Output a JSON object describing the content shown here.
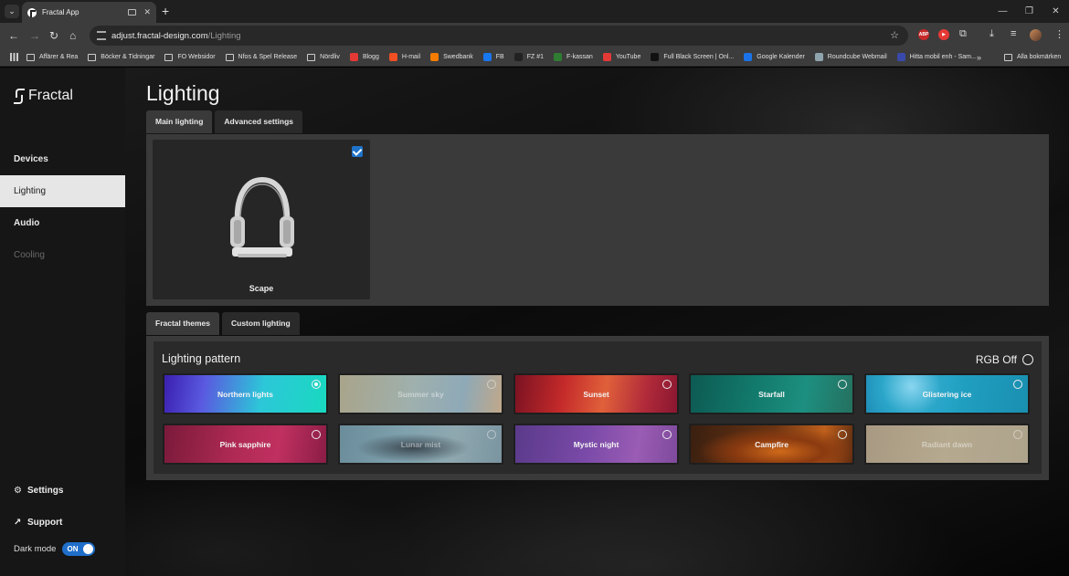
{
  "browser": {
    "tab_title": "Fractal App",
    "url_host": "adjust.fractal-design.com",
    "url_path": "/Lighting",
    "extensions": [
      {
        "name": "adblock-plus-icon",
        "label": "ABP",
        "color": "#c62828"
      },
      {
        "name": "youtube-ext-icon",
        "label": "▶",
        "color": "#e53935"
      }
    ],
    "bookmarks": [
      {
        "label": "Affärer & Rea",
        "icon": "folder"
      },
      {
        "label": "Böcker & Tidningar",
        "icon": "folder"
      },
      {
        "label": "FO Websidor",
        "icon": "folder"
      },
      {
        "label": "Nfos & Spel Release",
        "icon": "folder"
      },
      {
        "label": "Nördliv",
        "icon": "folder"
      },
      {
        "label": "Blogg",
        "icon": "blog",
        "color": "#e53935"
      },
      {
        "label": "H-mail",
        "icon": "microsoft",
        "color": "#f25022"
      },
      {
        "label": "Swedbank",
        "icon": "swedbank",
        "color": "#f57c00"
      },
      {
        "label": "FB",
        "icon": "facebook",
        "color": "#1877f2"
      },
      {
        "label": "FZ #1",
        "icon": "fz",
        "color": "#222222"
      },
      {
        "label": "F-kassan",
        "icon": "fkassan",
        "color": "#2e7d32"
      },
      {
        "label": "YouTube",
        "icon": "youtube",
        "color": "#e53935"
      },
      {
        "label": "Full Black Screen | Onl...",
        "icon": "screen",
        "color": "#111111"
      },
      {
        "label": "Google Kalender",
        "icon": "calendar",
        "color": "#1a73e8"
      },
      {
        "label": "Roundcube Webmail",
        "icon": "roundcube",
        "color": "#90a4ae"
      },
      {
        "label": "Hitta mobil enh - Sam...",
        "icon": "samsung",
        "color": "#3949ab"
      }
    ],
    "all_bookmarks": "Alla bokmärken"
  },
  "sidebar": {
    "brand": "Fractal",
    "items": [
      {
        "label": "Devices",
        "state": "normal"
      },
      {
        "label": "Lighting",
        "state": "active"
      },
      {
        "label": "Audio",
        "state": "normal"
      },
      {
        "label": "Cooling",
        "state": "disabled"
      }
    ],
    "settings": "Settings",
    "support": "Support",
    "dark_mode_label": "Dark mode",
    "dark_mode_value": "ON"
  },
  "main": {
    "title": "Lighting",
    "tabs": [
      {
        "label": "Main lighting",
        "active": true
      },
      {
        "label": "Advanced settings",
        "active": false
      }
    ],
    "device": {
      "name": "Scape",
      "selected": true
    },
    "theme_tabs": [
      {
        "label": "Fractal themes",
        "active": true
      },
      {
        "label": "Custom lighting",
        "active": false
      }
    ],
    "pattern_title": "Lighting pattern",
    "rgb_off": "RGB Off",
    "patterns": [
      {
        "label": "Northern lights",
        "selected": true,
        "dim": false,
        "gradient": "linear-gradient(100deg,#3a1fb0 0%,#5a5ae0 25%,#2cc7d8 60%,#19d9c0 100%)"
      },
      {
        "label": "Summer sky",
        "selected": false,
        "dim": true,
        "gradient": "linear-gradient(100deg,#a9a48a 0%,#9fb0ad 45%,#8ea9b7 75%,#c0a88a 100%)"
      },
      {
        "label": "Sunset",
        "selected": false,
        "dim": false,
        "gradient": "linear-gradient(100deg,#7a1222 0%,#c42a2a 30%,#e0603a 55%,#b02a3a 80%,#8a1630 100%)"
      },
      {
        "label": "Starfall",
        "selected": false,
        "dim": false,
        "gradient": "linear-gradient(100deg,#0d5a52 0%,#127a6c 40%,#1d8f80 70%,#25705f 100%)"
      },
      {
        "label": "Glistering ice",
        "selected": false,
        "dim": false,
        "gradient": "radial-gradient(circle at 28% 30%,#8ad6f0 0%,#2aa6c9 25%,transparent 45%),linear-gradient(100deg,#1f88b4 0%,#21a2c4 50%,#1a8fb0 100%)"
      },
      {
        "label": "Pink sapphire",
        "selected": false,
        "dim": false,
        "gradient": "linear-gradient(100deg,#7a1a3a 0%,#b02a55 45%,#c03060 70%,#8a1d45 100%)"
      },
      {
        "label": "Lunar mist",
        "selected": false,
        "dim": true,
        "gradient": "radial-gradient(ellipse at 45% 60%,#3b4750 0%,transparent 45%),linear-gradient(100deg,#6b8c9a 0%,#7fa2ae 40%,#8fa8b0 70%,#7a94a0 100%)"
      },
      {
        "label": "Mystic night",
        "selected": false,
        "dim": false,
        "gradient": "linear-gradient(100deg,#5a3a8a 0%,#7a4aa8 45%,#9a5cb4 75%,#7e4a9c 100%)"
      },
      {
        "label": "Campfire",
        "selected": false,
        "dim": false,
        "gradient": "radial-gradient(ellipse at 55% 70%,#d06a1a 0%,#8a3a10 35%,transparent 65%),linear-gradient(100deg,#3a1f10 0%,#6a3412 50%,#c0601c 80%,#5a2a10 100%)"
      },
      {
        "label": "Radiant dawn",
        "selected": false,
        "dim": true,
        "gradient": "linear-gradient(100deg,#a89a82 0%,#b5a98f 50%,#aea48c 100%)"
      }
    ]
  }
}
